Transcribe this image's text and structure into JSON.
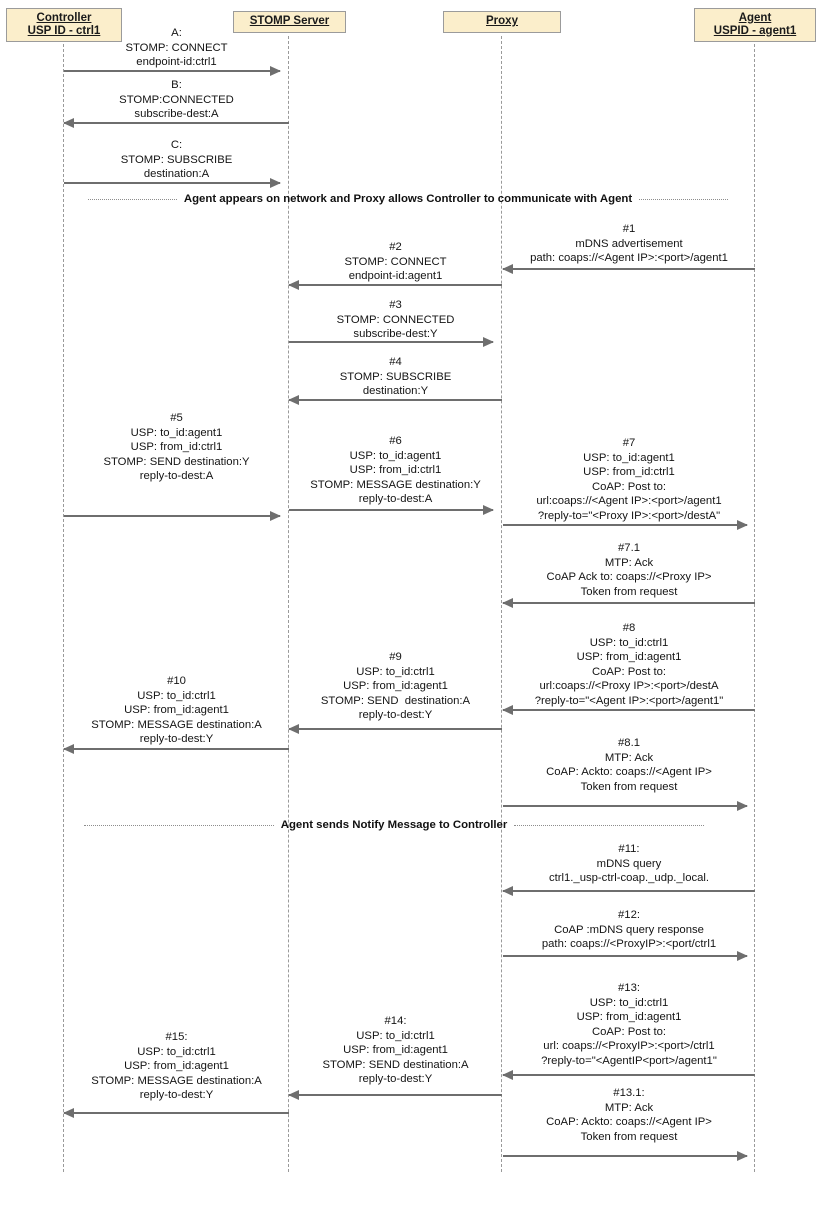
{
  "diagram": {
    "title": "USP Proxy sequence diagram (STOMP / CoAP)",
    "colors": {
      "participant_fill": "#fbeecb",
      "participant_border": "#9b9b9b",
      "lifeline": "#9a9a9a",
      "arrow": "#6e6e6e",
      "text": "#141414"
    }
  },
  "participants": [
    {
      "id": "controller",
      "line1": "Controller",
      "line2": "USP ID - ctrl1"
    },
    {
      "id": "stomp-server",
      "line1": "STOMP Server",
      "line2": ""
    },
    {
      "id": "proxy",
      "line1": "Proxy",
      "line2": ""
    },
    {
      "id": "agent",
      "line1": "Agent",
      "line2": "USPID - agent1"
    }
  ],
  "separators": [
    {
      "id": "sep-1",
      "text": "Agent appears on network and Proxy allows Controller to communicate with Agent"
    },
    {
      "id": "sep-2",
      "text": "Agent sends Notify Message to Controller"
    }
  ],
  "messages": [
    {
      "id": "msg-a",
      "label": "A:\nSTOMP: CONNECT\nendpoint-id:ctrl1",
      "from": "controller",
      "to": "stomp-server",
      "direction": "right"
    },
    {
      "id": "msg-b",
      "label": "B:\nSTOMP:CONNECTED\nsubscribe-dest:A",
      "from": "stomp-server",
      "to": "controller",
      "direction": "left"
    },
    {
      "id": "msg-c",
      "label": "C:\nSTOMP: SUBSCRIBE\ndestination:A",
      "from": "controller",
      "to": "stomp-server",
      "direction": "right"
    },
    {
      "id": "msg-1",
      "label": "#1\nmDNS advertisement\npath: coaps://<Agent IP>:<port>/agent1",
      "from": "agent",
      "to": "proxy",
      "direction": "left"
    },
    {
      "id": "msg-2",
      "label": "#2\nSTOMP: CONNECT\nendpoint-id:agent1",
      "from": "proxy",
      "to": "stomp-server",
      "direction": "left"
    },
    {
      "id": "msg-3",
      "label": "#3\nSTOMP: CONNECTED\nsubscribe-dest:Y",
      "from": "stomp-server",
      "to": "proxy",
      "direction": "right"
    },
    {
      "id": "msg-4",
      "label": "#4\nSTOMP: SUBSCRIBE\ndestination:Y",
      "from": "proxy",
      "to": "stomp-server",
      "direction": "left"
    },
    {
      "id": "msg-5",
      "label": "#5\nUSP: to_id:agent1\nUSP: from_id:ctrl1\nSTOMP: SEND destination:Y\nreply-to-dest:A",
      "from": "controller",
      "to": "stomp-server",
      "direction": "right"
    },
    {
      "id": "msg-6",
      "label": "#6\nUSP: to_id:agent1\nUSP: from_id:ctrl1\nSTOMP: MESSAGE destination:Y\nreply-to-dest:A",
      "from": "stomp-server",
      "to": "proxy",
      "direction": "right"
    },
    {
      "id": "msg-7",
      "label": "#7\nUSP: to_id:agent1\nUSP: from_id:ctrl1\nCoAP: Post to:\nurl:coaps://<Agent IP>:<port>/agent1\n?reply-to=\"<Proxy IP>:<port>/destA\"",
      "from": "proxy",
      "to": "agent",
      "direction": "right"
    },
    {
      "id": "msg-7-1",
      "label": "#7.1\nMTP: Ack\nCoAP Ack to: coaps://<Proxy IP>\nToken from request",
      "from": "agent",
      "to": "proxy",
      "direction": "left"
    },
    {
      "id": "msg-8",
      "label": "#8\nUSP: to_id:ctrl1\nUSP: from_id:agent1\nCoAP: Post to:\nurl:coaps://<Proxy IP>:<port>/destA\n?reply-to=\"<Agent IP>:<port>/agent1\"",
      "from": "agent",
      "to": "proxy",
      "direction": "left"
    },
    {
      "id": "msg-9",
      "label": "#9\nUSP: to_id:ctrl1\nUSP: from_id:agent1\nSTOMP: SEND  destination:A\nreply-to-dest:Y",
      "from": "proxy",
      "to": "stomp-server",
      "direction": "left"
    },
    {
      "id": "msg-10",
      "label": "#10\nUSP: to_id:ctrl1\nUSP: from_id:agent1\nSTOMP: MESSAGE destination:A\nreply-to-dest:Y",
      "from": "stomp-server",
      "to": "controller",
      "direction": "left"
    },
    {
      "id": "msg-8-1",
      "label": "#8.1\nMTP: Ack\nCoAP: Ackto: coaps://<Agent IP>\nToken from request",
      "from": "proxy",
      "to": "agent",
      "direction": "right"
    },
    {
      "id": "msg-11",
      "label": "#11:\nmDNS query\nctrl1._usp-ctrl-coap._udp._local.",
      "from": "agent",
      "to": "proxy",
      "direction": "left"
    },
    {
      "id": "msg-12",
      "label": "#12:\nCoAP :mDNS query response\npath: coaps://<ProxyIP>:<port/ctrl1",
      "from": "proxy",
      "to": "agent",
      "direction": "right"
    },
    {
      "id": "msg-13",
      "label": "#13:\nUSP: to_id:ctrl1\nUSP: from_id:agent1\nCoAP: Post to:\nurl: coaps://<ProxyIP>:<port>/ctrl1\n?reply-to=\"<AgentIP<port>/agent1\"",
      "from": "agent",
      "to": "proxy",
      "direction": "left"
    },
    {
      "id": "msg-14",
      "label": "#14:\nUSP: to_id:ctrl1\nUSP: from_id:agent1\nSTOMP: SEND destination:A\nreply-to-dest:Y",
      "from": "proxy",
      "to": "stomp-server",
      "direction": "left"
    },
    {
      "id": "msg-15",
      "label": "#15:\nUSP: to_id:ctrl1\nUSP: from_id:agent1\nSTOMP: MESSAGE destination:A\nreply-to-dest:Y",
      "from": "stomp-server",
      "to": "controller",
      "direction": "left"
    },
    {
      "id": "msg-13-1",
      "label": "#13.1:\nMTP: Ack\nCoAP: Ackto: coaps://<Agent IP>\nToken from request",
      "from": "proxy",
      "to": "agent",
      "direction": "right"
    }
  ]
}
